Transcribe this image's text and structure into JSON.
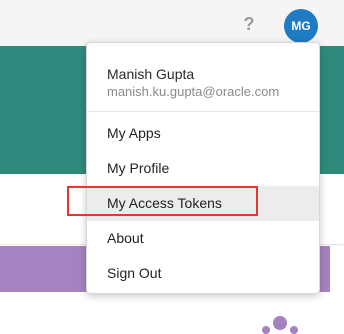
{
  "header": {
    "help_icon": "question-mark-icon",
    "help_glyph": "?",
    "avatar_initials": "MG"
  },
  "user_menu": {
    "user_name": "Manish Gupta",
    "user_email": "manish.ku.gupta@oracle.com",
    "items": [
      {
        "label": "My Apps"
      },
      {
        "label": "My Profile"
      },
      {
        "label": "My Access Tokens",
        "highlighted": true
      },
      {
        "label": "About"
      },
      {
        "label": "Sign Out"
      }
    ]
  },
  "colors": {
    "teal_banner": "#2f8a7d",
    "purple_bar": "#a583c0",
    "avatar": "#1f7bc3",
    "highlight": "#e8352e"
  }
}
